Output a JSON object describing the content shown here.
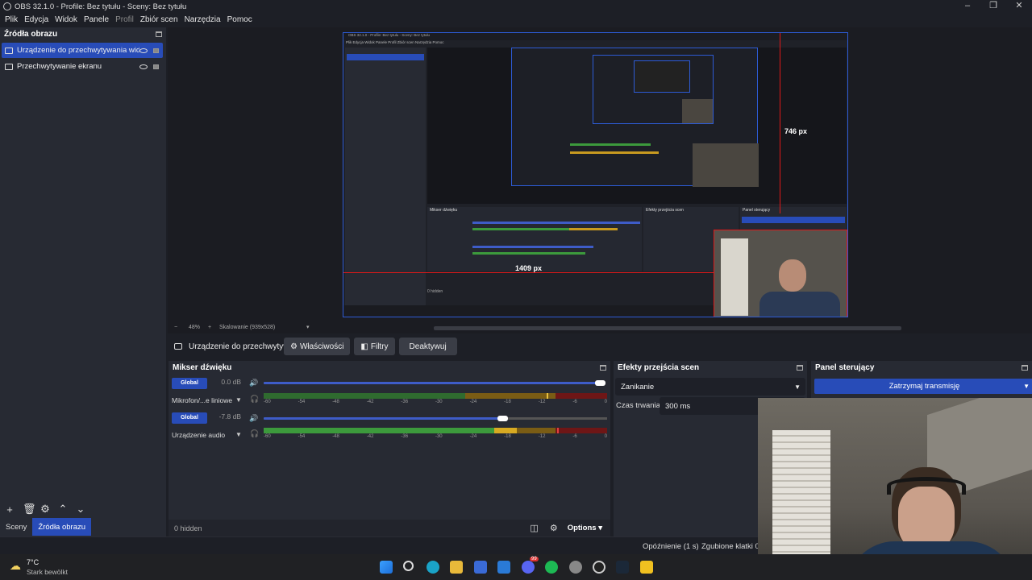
{
  "window": {
    "title": "OBS 32.1.0 - Profile: Bez tytułu - Sceny: Bez tytułu",
    "controls": [
      "–",
      "❐",
      "✕"
    ]
  },
  "menu": [
    "Plik",
    "Edycja",
    "Widok",
    "Panele",
    "Profil",
    "Zbiór scen",
    "Narzędzia",
    "Pomoc"
  ],
  "sources": {
    "title": "Źródła obrazu",
    "items": [
      {
        "label": "Urządzenie do przechwytywania wid",
        "selected": true
      },
      {
        "label": "Przechwytywanie ekranu",
        "selected": false
      }
    ],
    "toolbar": [
      "+",
      "🗑",
      "⚙",
      "⌃",
      "⌄"
    ],
    "tabs": [
      "Sceny",
      "Źródła obrazu"
    ]
  },
  "preview": {
    "measure_h": "1409 px",
    "measure_v": "746 px",
    "zoom": "48%",
    "scaling": "Skalowanie (939x528)",
    "nested": {
      "title": "OBS 32.1.0 - Profile: Bez tytułu - Sceny: Bez tytułu",
      "menu": "Plik  Edycja  Widok  Panele  Profil  Zbiór scen  Narzędzia  Pomoc",
      "mixer": "Mikser dźwięku",
      "trans": "Efekty przejścia scen",
      "panel": "Panel sterujący",
      "hidden": "0 hidden"
    }
  },
  "source_toolbar": {
    "name": "Urządzenie do przechwytyv",
    "buttons": [
      "Właściwości",
      "Filtry",
      "Deaktywuj"
    ]
  },
  "mixer": {
    "title": "Mikser dźwięku",
    "channels": [
      {
        "button": "Global",
        "db": "0.0 dB",
        "name": "Mikrofon/...e liniowe",
        "volume": 1.0
      },
      {
        "button": "Global",
        "db": "-7.8 dB",
        "name": "Urządzenie audio",
        "volume": 0.7
      }
    ],
    "ticks": [
      "-60",
      "-54",
      "-48",
      "-42",
      "-36",
      "-30",
      "-24",
      "-18",
      "-12",
      "-6",
      "0"
    ],
    "hidden": "0 hidden",
    "options": "Options"
  },
  "transitions": {
    "title": "Efekty przejścia scen",
    "selected": "Zanikanie",
    "duration_label": "Czas trwania",
    "duration": "300 ms"
  },
  "panel": {
    "title": "Panel sterujący",
    "stop_stream": "Zatrzymaj transmisję"
  },
  "status": {
    "delay": "Opóźnienie (1 s)",
    "dropped": "Zgubione klatki 0"
  },
  "taskbar": {
    "temp": "7°C",
    "weather": "Stark bewölkt",
    "badge": "99"
  },
  "colors": {
    "accent": "#284cb8",
    "meter_green": "#3c9a3c",
    "meter_yellow": "#c89a20",
    "meter_red": "#8e1a1a",
    "measure_line": "#e01818"
  }
}
